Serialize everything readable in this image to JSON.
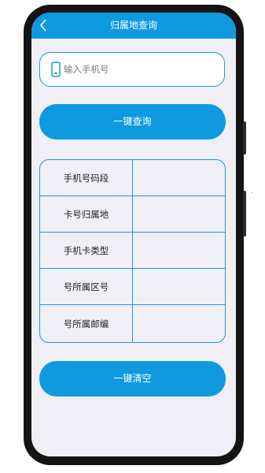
{
  "header": {
    "title": "归属地查询",
    "back_icon": "chevron-left-icon"
  },
  "search": {
    "placeholder": "输入手机号",
    "value": "",
    "icon": "mobile-phone-icon"
  },
  "buttons": {
    "query_label": "一键查询",
    "clear_label": "一键清空"
  },
  "info_table": {
    "rows": [
      {
        "label": "手机号码段",
        "value": ""
      },
      {
        "label": "卡号归属地",
        "value": ""
      },
      {
        "label": "手机卡类型",
        "value": ""
      },
      {
        "label": "号所属区号",
        "value": ""
      },
      {
        "label": "号所属邮编",
        "value": ""
      }
    ]
  },
  "colors": {
    "accent": "#0f9ae0",
    "border": "#1a9ad8",
    "background": "#f0eff5",
    "frame": "#141414"
  }
}
